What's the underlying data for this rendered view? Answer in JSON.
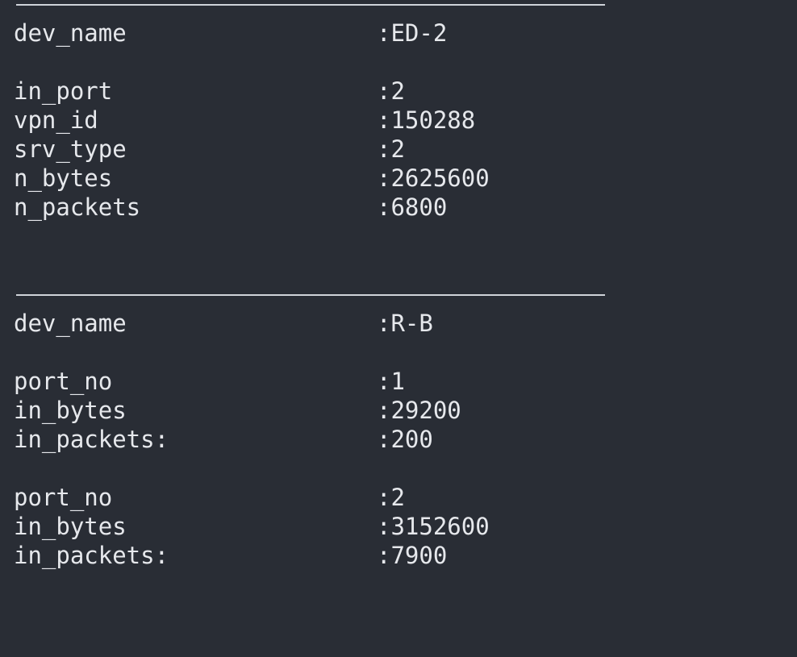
{
  "records": [
    {
      "rows": [
        {
          "key": "dev_name",
          "value": ":ED-2"
        },
        {
          "key": "in_port",
          "value": ":2"
        },
        {
          "key": "vpn_id",
          "value": ":150288"
        },
        {
          "key": "srv_type",
          "value": ":2"
        },
        {
          "key": "n_bytes",
          "value": ":2625600"
        },
        {
          "key": "n_packets",
          "value": ":6800"
        }
      ]
    },
    {
      "rows": [
        {
          "key": "dev_name",
          "value": ":R-B"
        },
        {
          "key": "port_no",
          "value": ":1"
        },
        {
          "key": "in_bytes",
          "value": ":29200"
        },
        {
          "key": "in_packets:",
          "value": ":200"
        },
        {
          "key": "port_no",
          "value": ":2"
        },
        {
          "key": "in_bytes",
          "value": ":3152600"
        },
        {
          "key": "in_packets:",
          "value": ":7900"
        }
      ]
    }
  ]
}
